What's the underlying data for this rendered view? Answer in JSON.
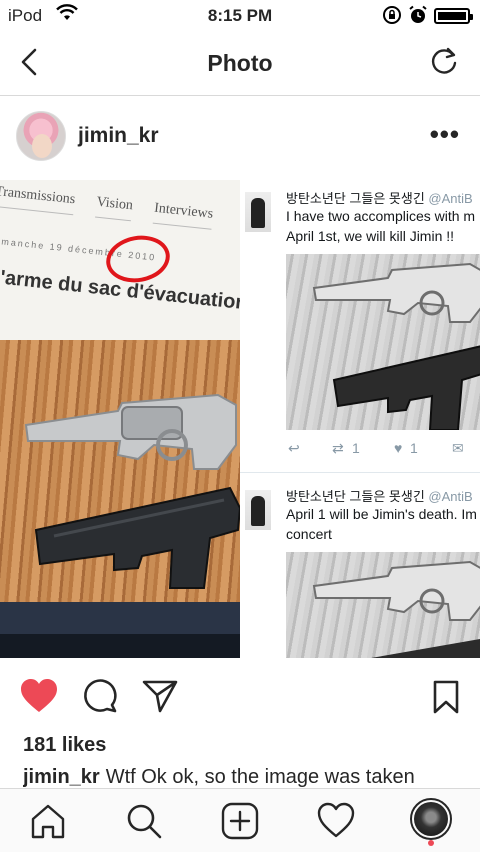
{
  "status_bar": {
    "carrier": "iPod",
    "time": "8:15 PM"
  },
  "navbar": {
    "title": "Photo"
  },
  "post": {
    "username": "jimin_kr",
    "photo": {
      "magazine": {
        "tabs": [
          "Transmissions",
          "Vision",
          "Interviews"
        ],
        "date_text": "imanche 19 décembre 2010",
        "headline": "l'arme du sac d'évacuation"
      },
      "tweets": [
        {
          "name": "방탄소년단 그들은 못생긴",
          "handle": "@AntiB",
          "lines": [
            "I have two accomplices with m",
            "April 1st, we will kill Jimin !!"
          ],
          "reply_count": "",
          "retweets": "1",
          "likes": "1"
        },
        {
          "name": "방탄소년단 그들은 못생긴",
          "handle": "@AntiB",
          "lines": [
            "April 1 will be Jimin's death. Im",
            "concert"
          ]
        }
      ]
    },
    "likes": "181 likes",
    "caption_user": "jimin_kr",
    "caption_text": "Wtf Ok ok, so the image was taken",
    "liked": true,
    "colors": {
      "like_red": "#ed4956",
      "circle_red": "#e0161b",
      "notification_dot": "#ed4956"
    }
  },
  "icons": {
    "status": [
      "wifi-icon",
      "rotation-lock-icon",
      "alarm-icon",
      "battery-icon"
    ],
    "navbar": [
      "back-chevron-icon",
      "refresh-icon"
    ],
    "post": [
      "more-dots-icon",
      "heart-filled-icon",
      "comment-icon",
      "share-icon",
      "bookmark-icon"
    ],
    "tabbar": [
      "home-icon",
      "search-icon",
      "add-icon",
      "activity-heart-icon",
      "profile-icon"
    ]
  }
}
